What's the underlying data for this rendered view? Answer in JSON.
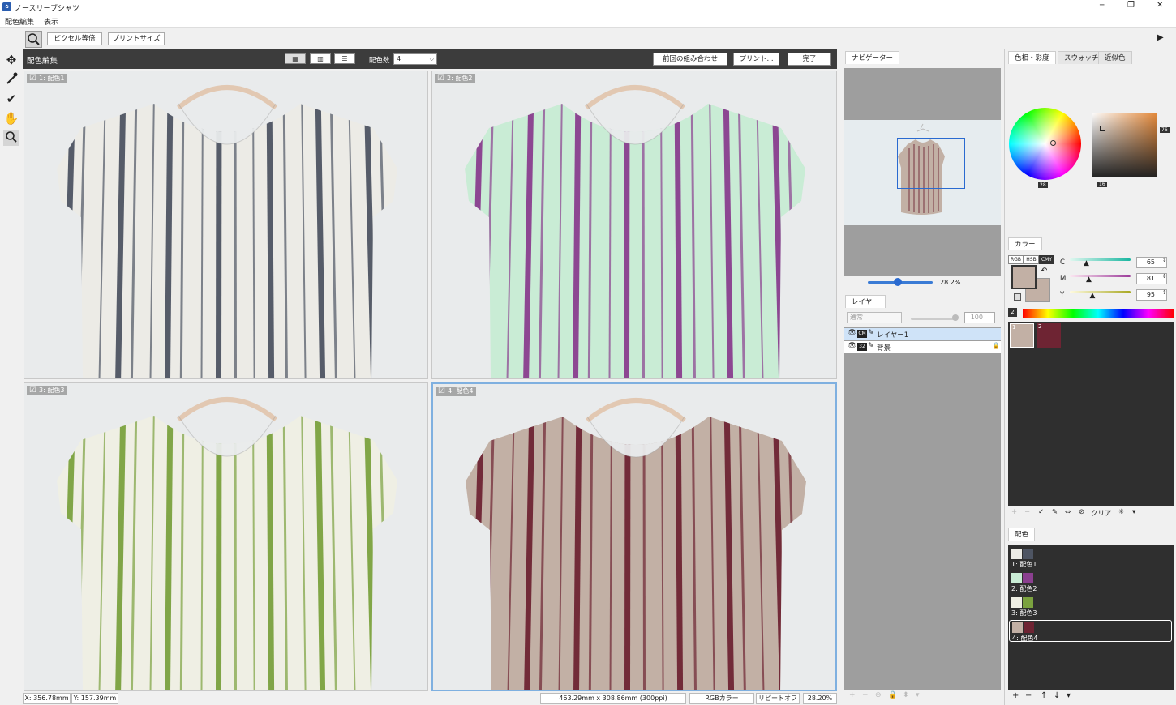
{
  "window": {
    "title": "ノースリーブシャツ",
    "minimize": "─",
    "restore": "❐",
    "close": "✕"
  },
  "menu": [
    "配色編集",
    "表示"
  ],
  "toolbar": {
    "pixel_label": "ピクセル等倍",
    "print_size_label": "プリントサイズ",
    "expand_arrow": "▶"
  },
  "editbar": {
    "title": "配色編集",
    "view_modes": [
      "▦",
      "▥",
      "☰"
    ],
    "color_count_label": "配色数",
    "color_count_value": "4",
    "prev_combo": "前回の組み合わせ",
    "print": "プリント...",
    "done": "完了"
  },
  "panels": [
    {
      "label": "1: 配色1",
      "bg": "#e9ebec",
      "stripe": "#4e5563",
      "fabric": "#ecebe6"
    },
    {
      "label": "2: 配色2",
      "bg": "#e9ebec",
      "stripe": "#8a3f8f",
      "fabric": "#c9ecd5"
    },
    {
      "label": "3: 配色3",
      "bg": "#e9ebec",
      "stripe": "#7ba23f",
      "fabric": "#efefe4"
    },
    {
      "label": "4: 配色4",
      "bg": "#e9ebec",
      "stripe": "#6e2433",
      "fabric": "#c2b0a5"
    }
  ],
  "status": {
    "x": "X: 356.78mm",
    "y": "Y: 157.39mm",
    "size": "463.29mm x 308.86mm (300ppi)",
    "colormode": "RGBカラー",
    "repeat": "リピートオフ",
    "zoom": "28.20%"
  },
  "navigator": {
    "tab": "ナビゲーター",
    "zoom": "28.2%"
  },
  "layers": {
    "tab": "レイヤー",
    "blend": "通常",
    "opacity": "100",
    "items": [
      {
        "name": "レイヤー1",
        "badge": "CM"
      },
      {
        "name": "背景",
        "badge": "32"
      }
    ],
    "footer_icons": [
      "+",
      "−",
      "⊖",
      "🔒",
      "⬍",
      "▾"
    ]
  },
  "colortabs": [
    "色相・彩度",
    "スウォッチ",
    "近似色"
  ],
  "colorwheel": {
    "wheel_value": "28",
    "sv_value": "16",
    "bright_value": "76"
  },
  "color": {
    "tab": "カラー",
    "modes": [
      "RGB",
      "HSB",
      "CMY"
    ],
    "channels": [
      {
        "label": "C",
        "value": "65",
        "pos": 0.28
      },
      {
        "label": "M",
        "value": "81",
        "pos": 0.32
      },
      {
        "label": "Y",
        "value": "95",
        "pos": 0.38
      }
    ],
    "fg": "#c2b0a5",
    "bg": "#c2b0a5",
    "palette_count": "2"
  },
  "swatches": [
    {
      "num": "1",
      "color": "#c2b0a5"
    },
    {
      "num": "2",
      "color": "#6e2433"
    }
  ],
  "swatch_footer": {
    "add": "+",
    "remove": "−",
    "check": "✓",
    "edit": "✎",
    "swap": "⇔",
    "ban": "⊘",
    "clear": "クリア",
    "star": "✳",
    "more": "▾"
  },
  "haishoku": {
    "tab": "配色",
    "items": [
      {
        "label": "1: 配色1",
        "c1": "#ecebe6",
        "c2": "#4e5563"
      },
      {
        "label": "2: 配色2",
        "c1": "#c9ecd5",
        "c2": "#8a3f8f"
      },
      {
        "label": "3: 配色3",
        "c1": "#efefe4",
        "c2": "#7ba23f"
      },
      {
        "label": "4: 配色4",
        "c1": "#c2b0a5",
        "c2": "#6e2433"
      }
    ],
    "footer_icons": [
      "+",
      "−",
      "↑",
      "↓",
      "▾"
    ]
  }
}
